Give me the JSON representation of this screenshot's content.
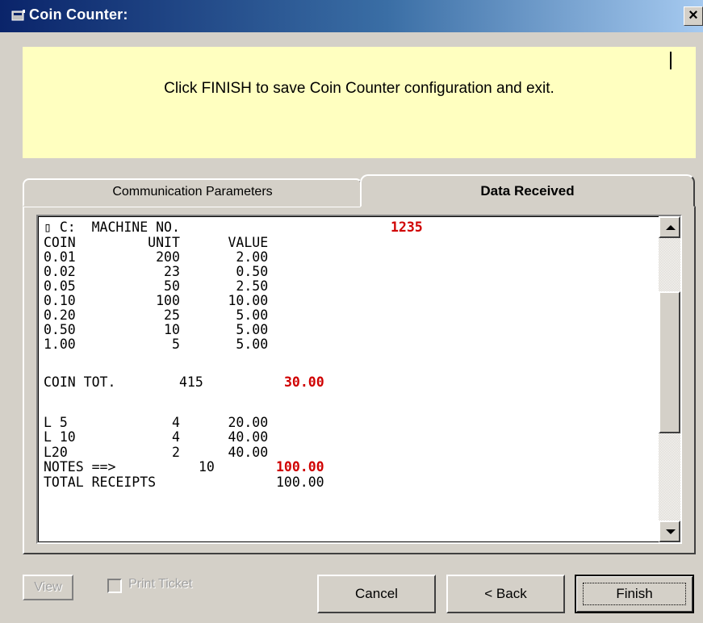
{
  "window": {
    "title": "Coin Counter:",
    "close_label": "×"
  },
  "message": {
    "text": "Click FINISH to save Coin Counter configuration and exit."
  },
  "tabs": [
    {
      "label": "Communication Parameters",
      "active": false
    },
    {
      "label": "Data Received",
      "active": true
    }
  ],
  "data_received": {
    "machine_prefix": "▯ C:",
    "machine_label": "MACHINE NO.",
    "machine_no": "1235",
    "coin_header": "COIN         UNIT      VALUE",
    "coin_rows": [
      "0.01          200       2.00",
      "0.02           23       0.50",
      "0.05           50       2.50",
      "0.10          100      10.00",
      "0.20           25       5.00",
      "0.50           10       5.00",
      "1.00            5       5.00"
    ],
    "coin_total_label": "COIN TOT.",
    "coin_total_units": "415",
    "coin_total_value": "30.00",
    "note_rows": [
      "L 5             4      20.00",
      "L 10            4      40.00",
      "L20             2      40.00"
    ],
    "notes_label": "NOTES ==>",
    "notes_units": "10",
    "notes_value": "100.00",
    "total_receipts_label": "TOTAL RECEIPTS",
    "total_receipts_value": "100.00"
  },
  "buttons": {
    "view": "View",
    "print_ticket": "Print Ticket",
    "cancel": "Cancel",
    "back": "< Back",
    "finish": "Finish"
  },
  "colors": {
    "highlight_red": "#d00000",
    "message_bg": "#ffffc0",
    "titlebar": "#0a246a"
  }
}
